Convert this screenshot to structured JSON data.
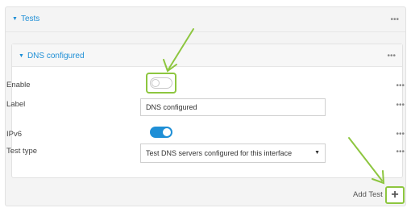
{
  "outer": {
    "title": "Tests",
    "menu": "•••"
  },
  "inner": {
    "title": "DNS configured",
    "menu": "•••"
  },
  "fields": {
    "enable": {
      "label": "Enable",
      "state": "off",
      "menu": "•••"
    },
    "label": {
      "label": "Label",
      "value": "DNS configured",
      "menu": "•••"
    },
    "ipv6": {
      "label": "IPv6",
      "state": "on",
      "menu": "•••"
    },
    "test_type": {
      "label": "Test type",
      "value": "Test DNS servers configured for this interface",
      "menu": "•••"
    }
  },
  "add": {
    "label": "Add Test",
    "icon": "plus-icon",
    "symbol": "+"
  },
  "colors": {
    "accent": "#1f8fd6",
    "highlight": "#8dc63f"
  }
}
